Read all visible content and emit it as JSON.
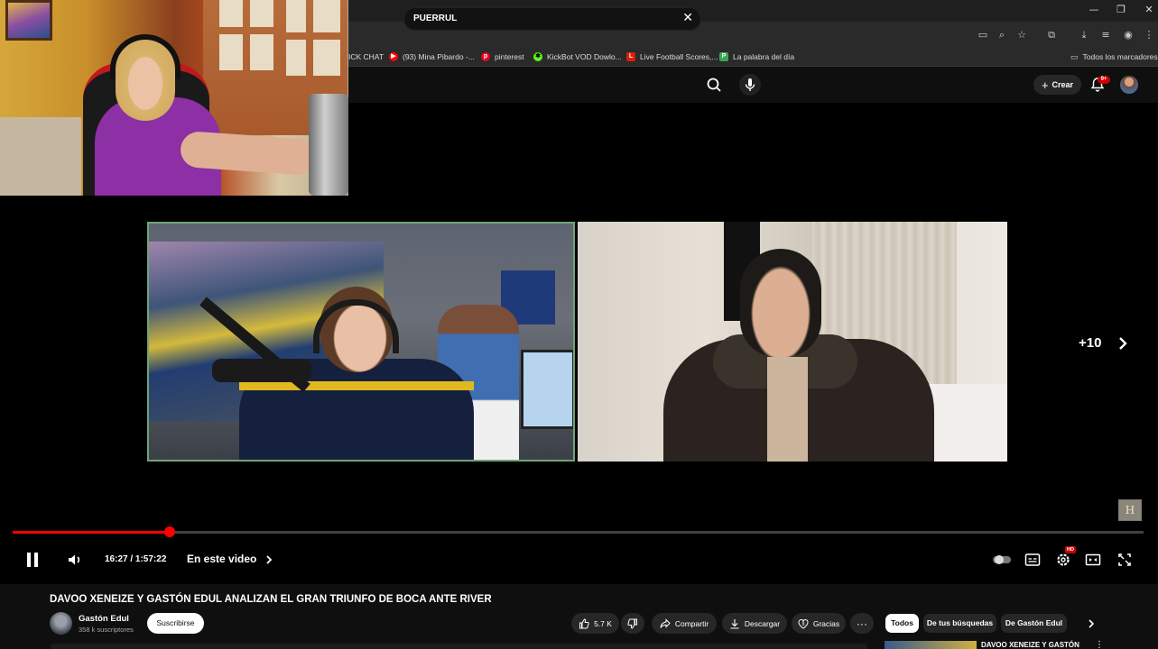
{
  "bookmarks": [
    {
      "label": "ICK CHAT",
      "icon": "none"
    },
    {
      "label": "(93) Mina Pibardo -...",
      "icon": "youtube-icon",
      "color": "#ff0000"
    },
    {
      "label": "pinterest",
      "icon": "pinterest-icon",
      "color": "#e60023"
    },
    {
      "label": "KickBot VOD Dowlo...",
      "icon": "kickbot-icon",
      "color": "#53fc18"
    },
    {
      "label": "Live Football Scores,...",
      "icon": "livescore-icon",
      "color": "#d81e05"
    },
    {
      "label": "La palabra del día",
      "icon": "p-icon",
      "color": "#3aa757"
    },
    {
      "label": "Todos los marcadores",
      "icon": "folder-icon"
    }
  ],
  "search": {
    "query": "PUERRUL"
  },
  "header": {
    "create_label": "Crear",
    "notifications": "9+"
  },
  "player": {
    "more_participants": "+10",
    "time": "16:27 / 1:57:22",
    "chapter_label": "En este video",
    "progress": 0.1392,
    "hd_badge": "HD",
    "corner_logo": "H"
  },
  "video": {
    "title": "DAVOO XENEIZE Y GASTÓN EDUL ANALIZAN EL GRAN TRIUNFO DE BOCA ANTE RIVER",
    "channel": "Gastón Edul",
    "subscribers": "358 k suscriptores",
    "subscribe_label": "Suscribirse",
    "likes": "5.7 K",
    "share_label": "Compartir",
    "download_label": "Descargar",
    "thanks_label": "Gracias"
  },
  "chips": [
    "Todos",
    "De tus búsquedas",
    "De Gastón Edul"
  ],
  "recommendation": {
    "title": "DAVOO XENEIZE Y GASTÓN"
  },
  "colors": {
    "accent": "#ff0000",
    "background": "#0f0f0f"
  }
}
